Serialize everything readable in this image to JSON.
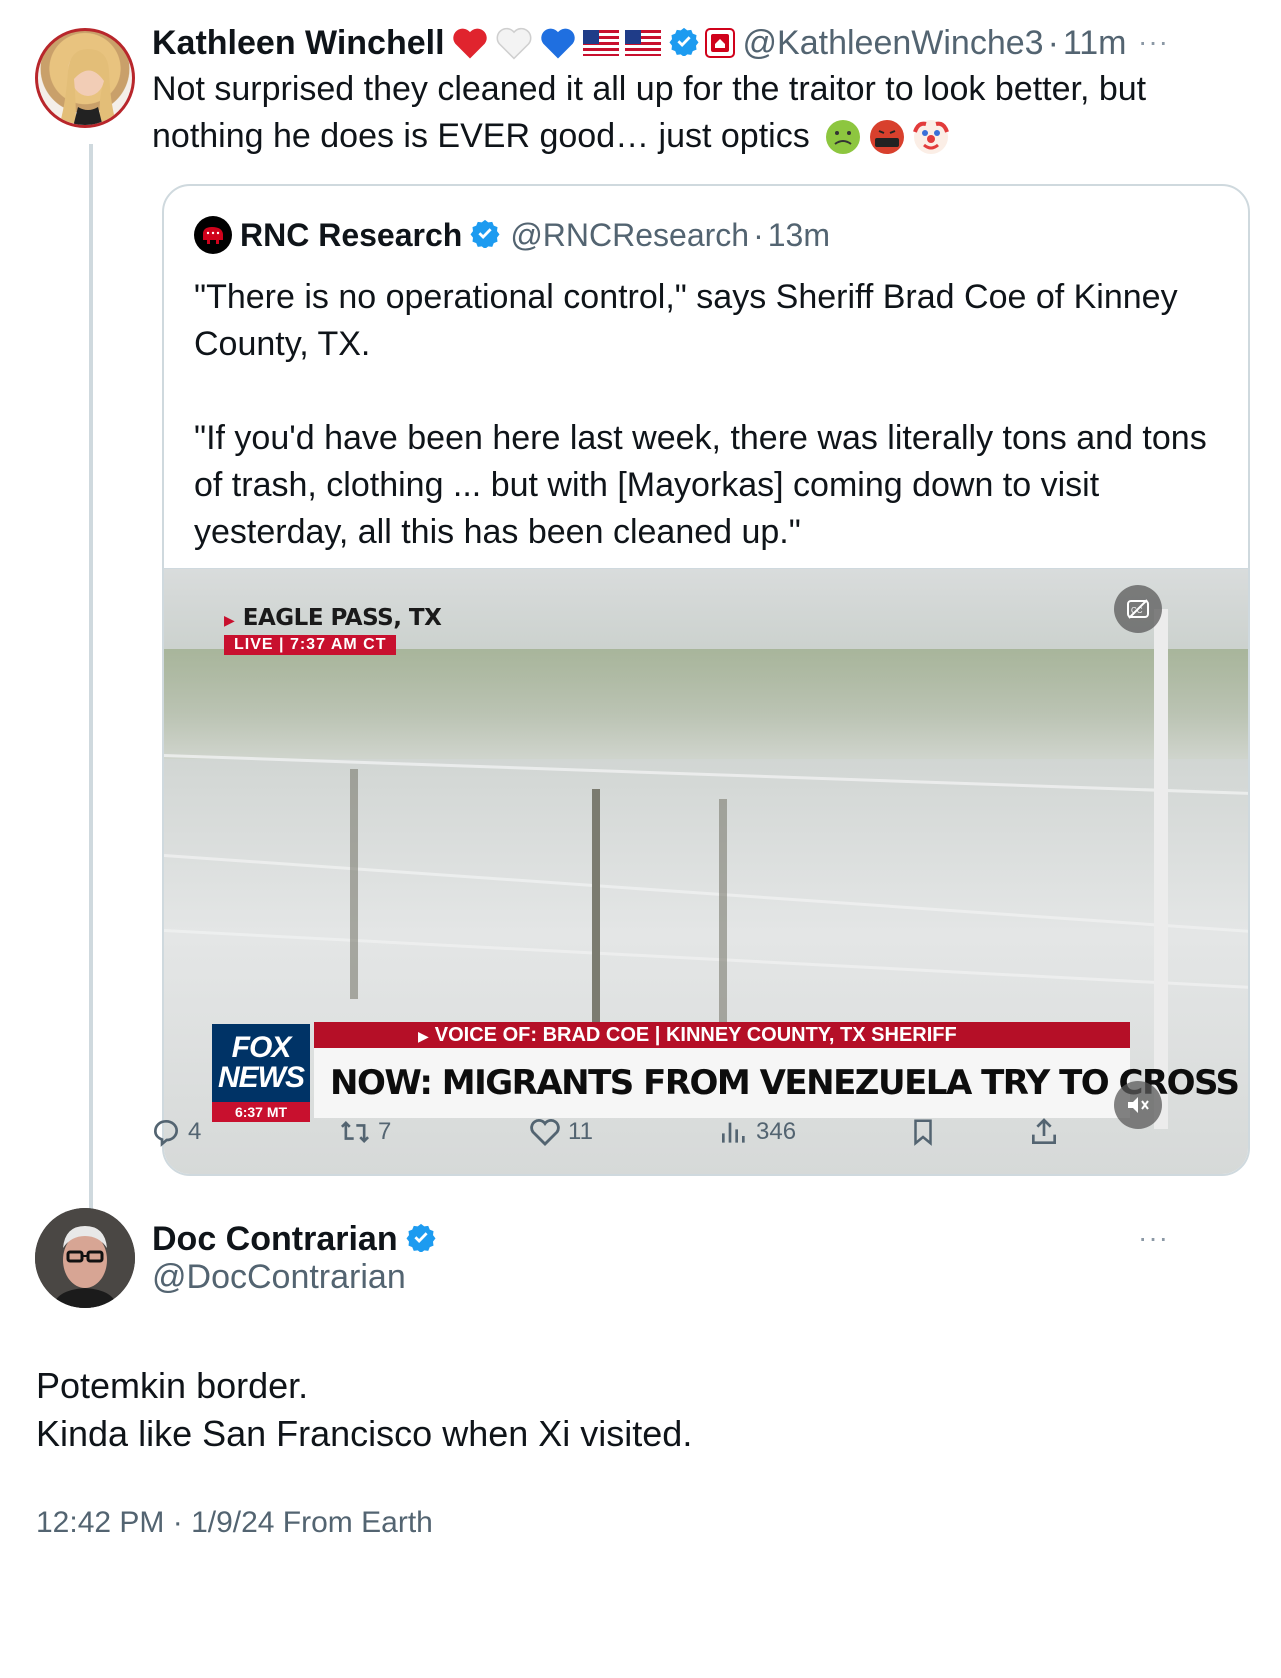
{
  "parent_tweet": {
    "author_name": "Kathleen Winchell",
    "badges": [
      "heart-red",
      "heart-white",
      "heart-blue",
      "flag-us",
      "flag-us",
      "verified",
      "affiliate"
    ],
    "handle": "@KathleenWinche3",
    "separator": "·",
    "time": "11m",
    "text_line1": "Not surprised they cleaned it all up for the traitor to look better, but",
    "text_line2": "nothing he does is EVER good… just optics",
    "trailing_emojis": [
      "nauseated-face",
      "face-with-symbols",
      "clown-face"
    ],
    "more": "···"
  },
  "quoted_tweet": {
    "author_name": "RNC Research",
    "handle": "@RNCResearch",
    "separator": "·",
    "time": "13m",
    "paragraph1_line1": "\"There is no operational control,\" says Sheriff Brad Coe of Kinney",
    "paragraph1_line2": "County, TX.",
    "paragraph2_line1": "\"If you'd have been here last week, there was literally tons and tons",
    "paragraph2_line2": "of trash, clothing ... but with [Mayorkas] coming down to visit",
    "paragraph2_line3": "yesterday, all this has been cleaned up.\"",
    "video": {
      "location": "EAGLE PASS, TX",
      "live_label": "LIVE",
      "live_time": "7:37 AM CT",
      "logo_line1": "FOX",
      "logo_line2": "NEWS",
      "logo_time": "6:37 MT",
      "lower_third_top": "VOICE OF: BRAD COE | KINNEY COUNTY, TX SHERIFF",
      "lower_third_headline": "NOW: MIGRANTS FROM VENEZUELA TRY TO CROSS BORDER"
    }
  },
  "actions": {
    "replies": "4",
    "reposts": "7",
    "likes": "11",
    "views": "346"
  },
  "reply_tweet": {
    "author_name": "Doc Contrarian",
    "handle": "@DocContrarian",
    "more": "···",
    "text_line1": "Potemkin border.",
    "text_line2": "Kinda like San Francisco when Xi visited.",
    "timestamp": "12:42 PM · 1/9/24 From Earth"
  },
  "colors": {
    "text": "#0f1419",
    "secondary": "#536471",
    "verified": "#1d9bf0",
    "border": "#cfd9de",
    "fox_red": "#c8102e",
    "fox_blue": "#003366"
  }
}
